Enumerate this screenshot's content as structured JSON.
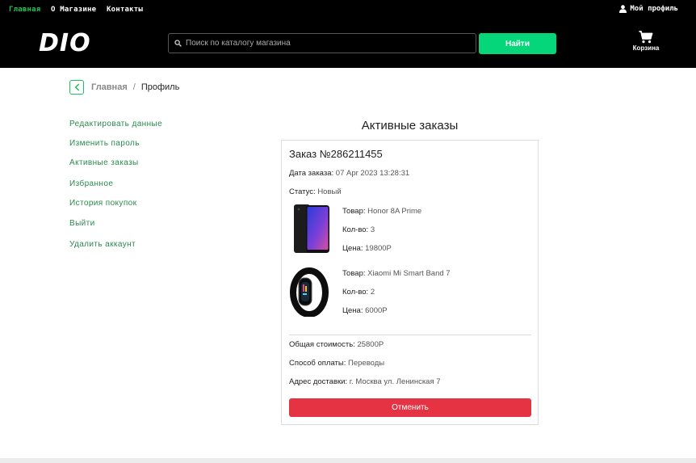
{
  "topnav": {
    "home": "Главная",
    "about": "О Магазине",
    "contacts": "Контакты",
    "profile": "Мой профиль"
  },
  "header": {
    "logo": "DIO",
    "search_placeholder": "Поиск по каталогу магазина",
    "search_button": "Найти",
    "cart_label": "Корзина"
  },
  "breadcrumb": {
    "home": "Главная",
    "separator": "/",
    "current": "Профиль"
  },
  "sidebar": {
    "items": [
      {
        "label": "Редактировать данные"
      },
      {
        "label": "Изменить пароль"
      },
      {
        "label": "Активные заказы"
      },
      {
        "label": "Избранное"
      },
      {
        "label": "История покупок"
      },
      {
        "label": "Выйти"
      },
      {
        "label": "Удалить аккаунт"
      }
    ]
  },
  "main": {
    "title": "Активные заказы",
    "order": {
      "number": "Заказ №286211455",
      "date_label": "Дата заказа:",
      "date": "07 Apr 2023 13:28:31",
      "status_label": "Статус:",
      "status": "Новый",
      "products": [
        {
          "product_label": "Товар:",
          "name": "Honor 8A Prime",
          "qty_label": "Кол-во:",
          "qty": "3",
          "price_label": "Цена:",
          "price": "19800Р"
        },
        {
          "product_label": "Товар:",
          "name": "Xiaomi Mi Smart Band 7",
          "qty_label": "Кол-во:",
          "qty": "2",
          "price_label": "Цена:",
          "price": "6000Р"
        }
      ],
      "total_label": "Общая стоимость:",
      "total": "25800Р",
      "payment_label": "Способ оплаты:",
      "payment": "Переводы",
      "address_label": "Адрес доставки:",
      "address": "г. Москва ул. Ленинская 7",
      "cancel_button": "Отменить"
    }
  },
  "colors": {
    "accent_green": "#05d67a",
    "menu_green": "#2a8a4e",
    "cancel_red": "#e63344",
    "header_bg": "#000000"
  },
  "icons": [
    "user-icon",
    "search-icon",
    "cart-icon",
    "chevron-left-icon"
  ]
}
